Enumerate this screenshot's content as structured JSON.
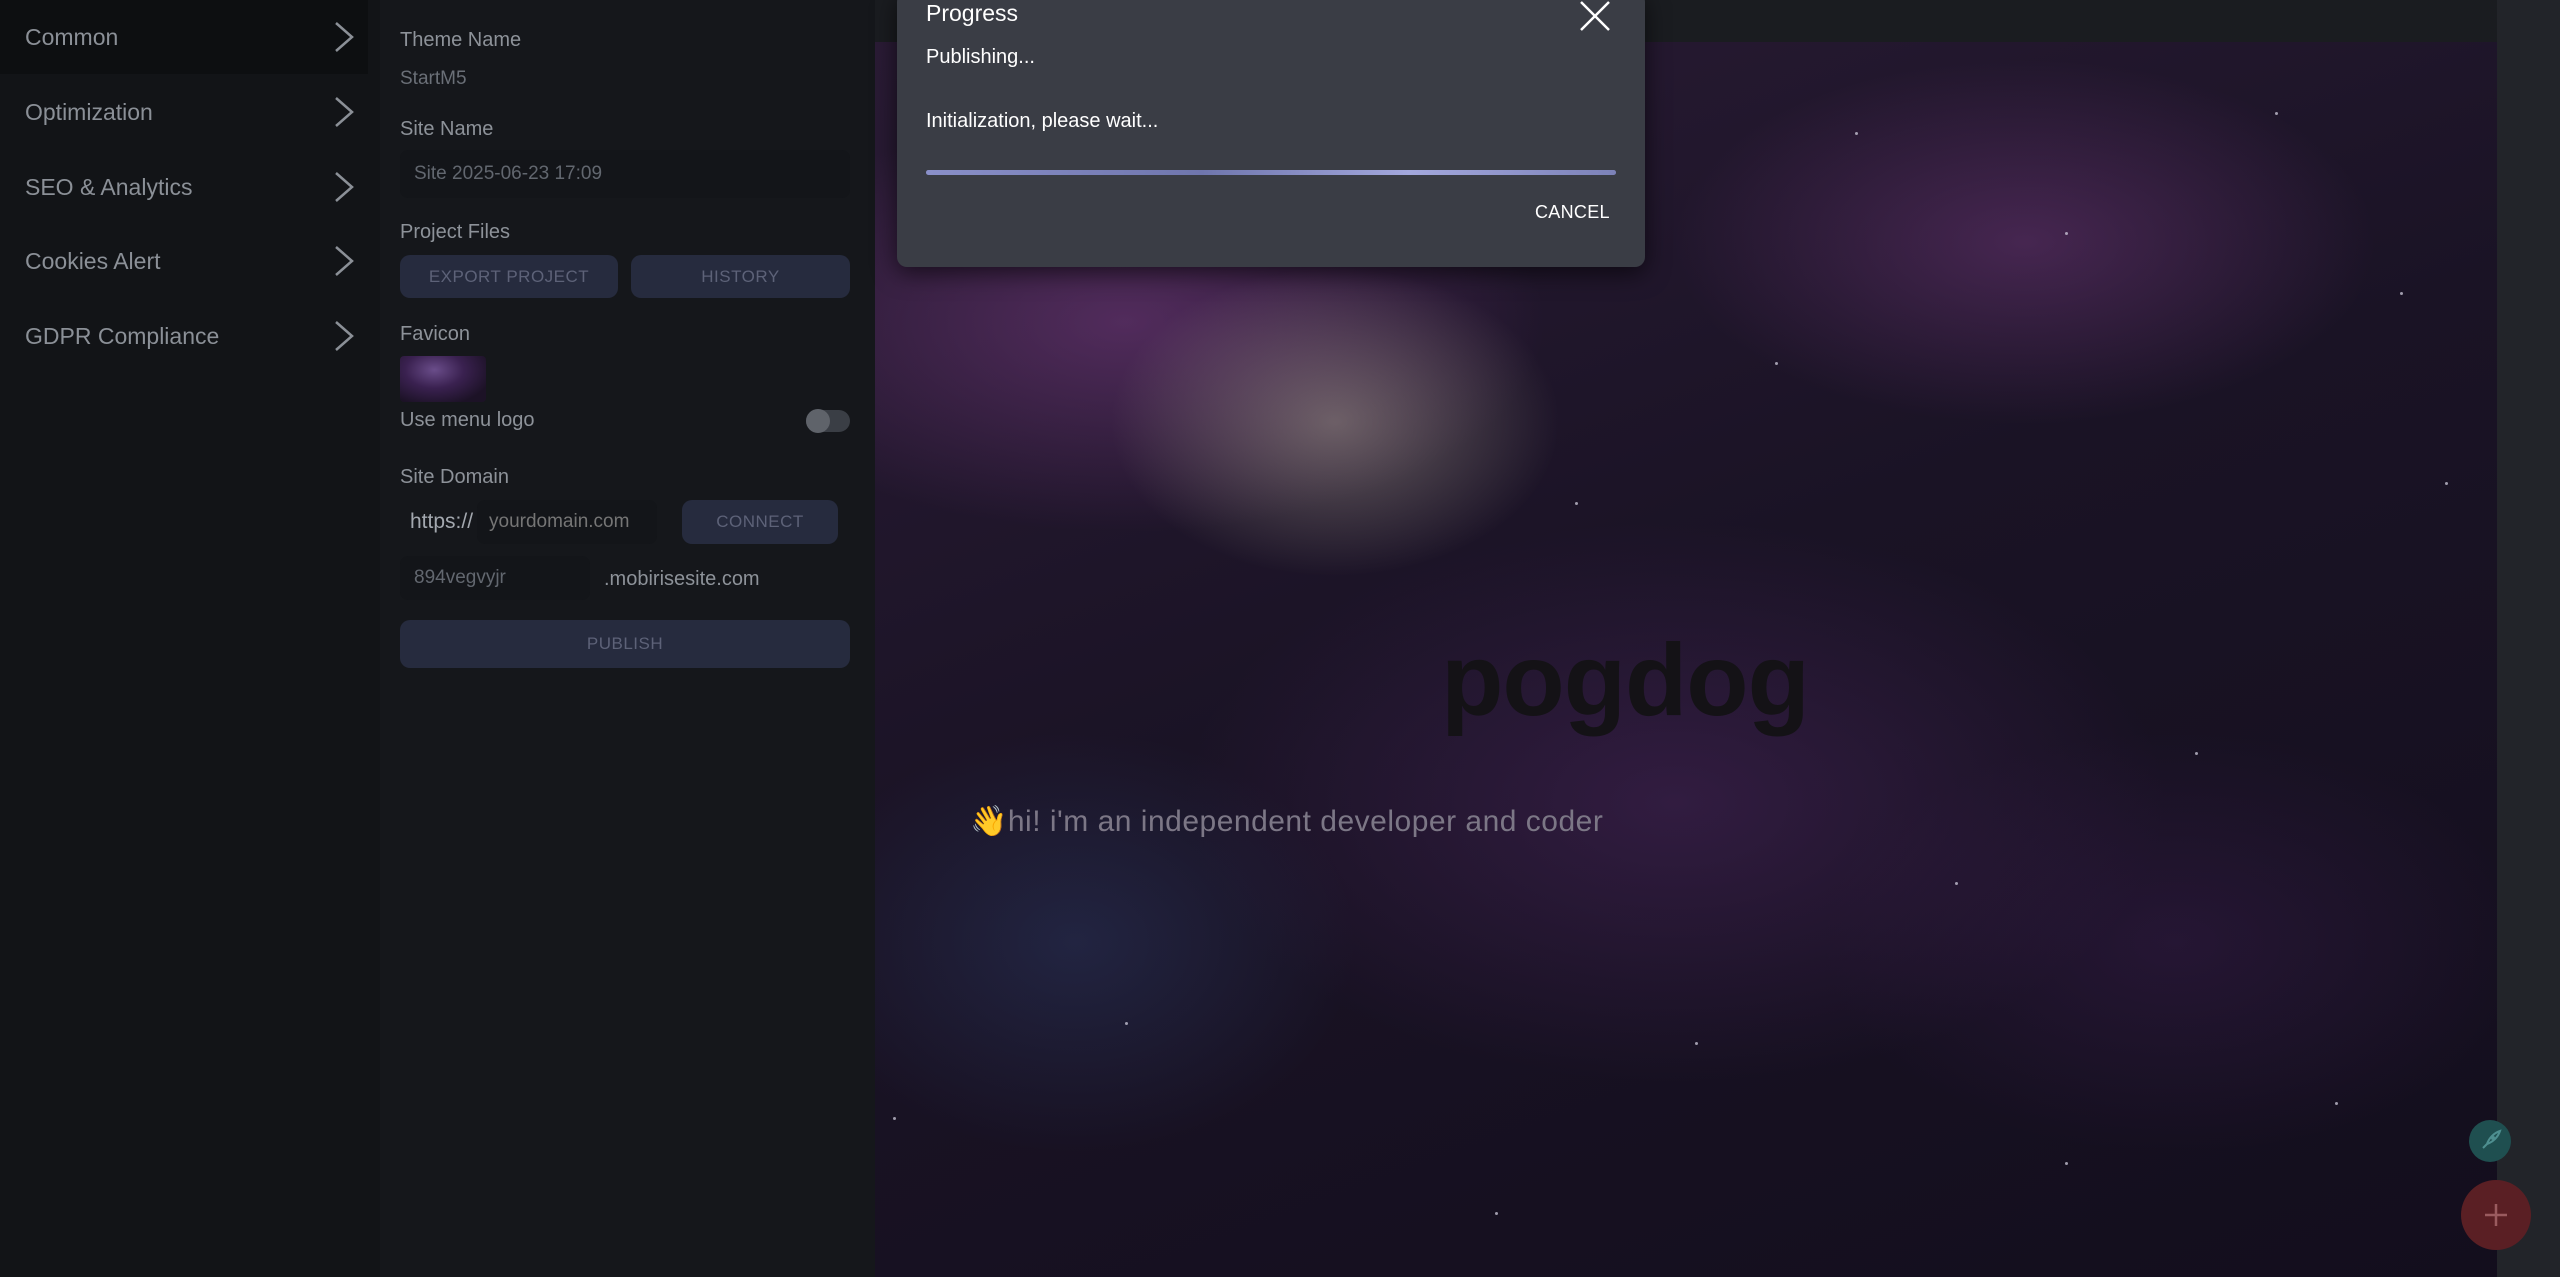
{
  "nav": {
    "items": [
      {
        "label": "Common",
        "active": true
      },
      {
        "label": "Optimization",
        "active": false
      },
      {
        "label": "SEO & Analytics",
        "active": false
      },
      {
        "label": "Cookies Alert",
        "active": false
      },
      {
        "label": "GDPR Compliance",
        "active": false
      }
    ]
  },
  "settings": {
    "theme_name_label": "Theme Name",
    "theme_name_value": "StartM5",
    "site_name_label": "Site Name",
    "site_name_value": "Site 2025-06-23 17:09",
    "project_files_label": "Project Files",
    "export_button": "EXPORT PROJECT",
    "history_button": "HISTORY",
    "favicon_label": "Favicon",
    "menu_logo_label": "Use menu logo",
    "menu_logo_enabled": false,
    "site_domain_label": "Site Domain",
    "domain_prefix": "https://",
    "domain_placeholder": "yourdomain.com",
    "connect_button": "CONNECT",
    "subdomain_value": "894vegvyjr",
    "subdomain_suffix": ".mobirisesite.com",
    "publish_button": "PUBLISH"
  },
  "preview": {
    "hero_title": "pogdog",
    "hero_subtitle": "👋hi! i'm an independent developer and coder"
  },
  "modal": {
    "title": "Progress",
    "status": "Publishing...",
    "message": "Initialization, please wait...",
    "progress": 1.0,
    "cancel_label": "CANCEL"
  },
  "colors": {
    "accent": "#6f76ad",
    "fab_teal": "#1f4f50",
    "fab_red": "#5a1f24"
  }
}
